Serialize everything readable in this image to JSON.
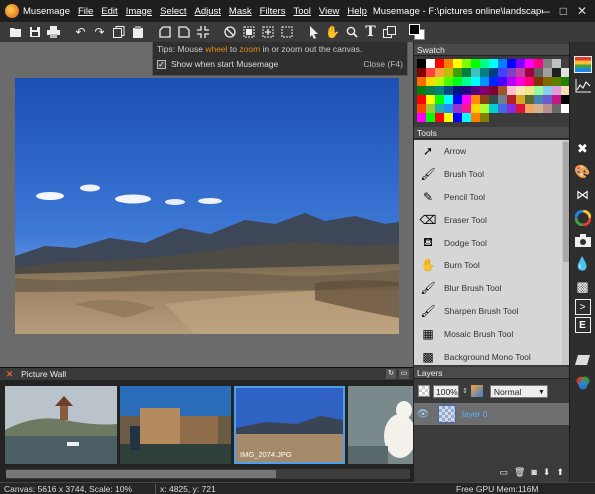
{
  "app": {
    "name": "Musemage",
    "window_title": "Musemage - F:\\pictures online\\landscape\\photos...",
    "menus": [
      "File",
      "Edit",
      "Image",
      "Select",
      "Adjust",
      "Mask",
      "Filters",
      "Tool",
      "View",
      "Help"
    ],
    "window_buttons": [
      "–",
      "□",
      "✕"
    ]
  },
  "tip": {
    "prefix": "Tips: Mouse ",
    "wheel": "wheel",
    "to": " to ",
    "zoom": "zoom",
    "suffix": " in or zoom out the canvas.",
    "checkbox_label": "Show when start Musemage",
    "checked": true,
    "close_label": "Close (F4)"
  },
  "swatch": {
    "title": "Swatch",
    "colors": [
      "#000000",
      "#ffffff",
      "#ff0000",
      "#ff8000",
      "#ffff00",
      "#80ff00",
      "#00ff00",
      "#00ff80",
      "#00ffff",
      "#0080ff",
      "#0000ff",
      "#8000ff",
      "#ff00ff",
      "#ff0080",
      "#808080",
      "#c0c0c0",
      "#404040",
      "#800000",
      "#ff4040",
      "#ff9f40",
      "#c0c000",
      "#40a000",
      "#008040",
      "#40c0c0",
      "#008080",
      "#004080",
      "#4040ff",
      "#8040c0",
      "#c040a0",
      "#a00040",
      "#606060",
      "#a0a0a0",
      "#202020",
      "#e0e0e0",
      "#ff6a00",
      "#ffd800",
      "#b6ff00",
      "#4cff00",
      "#00ff21",
      "#00ff90",
      "#00ffff",
      "#0094ff",
      "#0026ff",
      "#4800ff",
      "#b200ff",
      "#ff00dc",
      "#ff006e",
      "#7f3300",
      "#7f6a00",
      "#5b7f00",
      "#267f00",
      "#007f0e",
      "#007f46",
      "#007f7f",
      "#004a7f",
      "#00137f",
      "#21007f",
      "#57007f",
      "#7f006e",
      "#7f0037",
      "#a0522d",
      "#ffc0cb",
      "#ffe4b5",
      "#f0e68c",
      "#98fb98",
      "#87ceeb",
      "#dda0dd",
      "#f5deb3",
      "#ff0000",
      "#ffff00",
      "#00ff00",
      "#00ffff",
      "#0000ff",
      "#ff00ff",
      "#ff8c00",
      "#8b4513",
      "#2f4f4f",
      "#708090",
      "#b22222",
      "#daa520",
      "#556b2f",
      "#4682b4",
      "#6a5acd",
      "#c71585",
      "#000000",
      "#ff4500",
      "#9acd32",
      "#20b2aa",
      "#1e90ff",
      "#9932cc",
      "#ff1493",
      "#ffd700",
      "#adff2f",
      "#00ced1",
      "#4169e1",
      "#8a2be2",
      "#dc143c",
      "#f4a460",
      "#d2b48c",
      "#bc8f8f",
      "#696969",
      "#ffffff",
      "#ff00ff",
      "#00ff00",
      "#ff0000",
      "#ffff00",
      "#0000ff",
      "#00ffff",
      "#ff8000",
      "#808000"
    ]
  },
  "tools": {
    "title": "Tools",
    "items": [
      {
        "label": "Arrow",
        "icon": "arrow-icon",
        "glyph": "➚"
      },
      {
        "label": "Brush Tool",
        "icon": "brush-icon",
        "glyph": "🖌"
      },
      {
        "label": "Pencil Tool",
        "icon": "pencil-icon",
        "glyph": "✎"
      },
      {
        "label": "Eraser Tool",
        "icon": "eraser-icon",
        "glyph": "⌫"
      },
      {
        "label": "Dodge Tool",
        "icon": "dodge-icon",
        "glyph": "⛾"
      },
      {
        "label": "Burn Tool",
        "icon": "burn-icon",
        "glyph": "✋"
      },
      {
        "label": "Blur Brush Tool",
        "icon": "blur-brush-icon",
        "glyph": "🖌"
      },
      {
        "label": "Sharpen Brush Tool",
        "icon": "sharpen-brush-icon",
        "glyph": "🖌"
      },
      {
        "label": "Mosaic Brush Tool",
        "icon": "mosaic-brush-icon",
        "glyph": "▦"
      },
      {
        "label": "Background Mono Tool",
        "icon": "background-mono-icon",
        "glyph": "▩"
      }
    ]
  },
  "layers": {
    "title": "Layers",
    "opacity": "100%",
    "blend_mode": "Normal",
    "items": [
      {
        "name": "layer 0",
        "visible": true
      }
    ]
  },
  "picture_wall": {
    "title": "Picture Wall",
    "selected_name": "IMG_2074.JPG"
  },
  "status": {
    "canvas": "Canvas: 5616 x 3744, Scale: 10%",
    "coords": "x: 4825, y: 721",
    "memory": "Free GPU Mem:116M"
  },
  "colors": {
    "accent": "#4ea0ea",
    "tip_highlight": "#e08a1e",
    "layer_name": "#5ab0ff"
  }
}
